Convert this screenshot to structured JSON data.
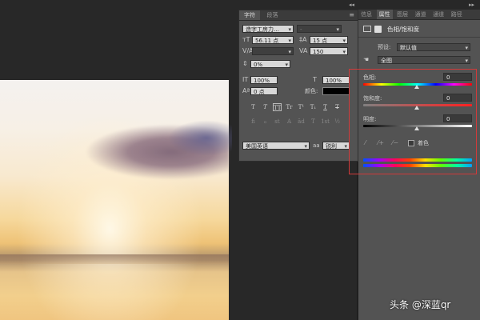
{
  "character_panel": {
    "tabs": [
      "字符",
      "段落"
    ],
    "font_family": "造字工房力…",
    "font_style": "-",
    "font_size": "56.11 点",
    "leading": "15 点",
    "kerning": "",
    "tracking": "150",
    "baseline_shift_pct": "0%",
    "vertical_scale": "100%",
    "horizontal_scale": "100%",
    "baseline_shift": "0 点",
    "color_label": "颜色:",
    "color_value": "#000000",
    "type_style_buttons": [
      "T",
      "T",
      "TT",
      "Tr",
      "T¹",
      "T₁",
      "T",
      "T"
    ],
    "opentype_buttons": [
      "fi",
      "ℴ",
      "st",
      "A",
      "ād",
      "T",
      "1st",
      "½"
    ],
    "language": "美国英语",
    "aa_label": "aa",
    "antialias": "锐利"
  },
  "properties_panel": {
    "tabs": [
      "信息",
      "属性",
      "图层",
      "通道",
      "通道",
      "路径"
    ],
    "adjustment_title": "色相/饱和度",
    "preset_label": "预设:",
    "preset_value": "默认值",
    "channel_value": "全图",
    "hue_label": "色相:",
    "hue_value": "0",
    "saturation_label": "饱和度:",
    "saturation_value": "0",
    "lightness_label": "明度:",
    "lightness_value": "0",
    "colorize_label": "着色"
  },
  "watermark": "头条 @深蓝qr",
  "colors": {
    "panel_bg": "#535353",
    "field_bg": "#3f3f3f",
    "highlight_box": "#d23a3a"
  }
}
